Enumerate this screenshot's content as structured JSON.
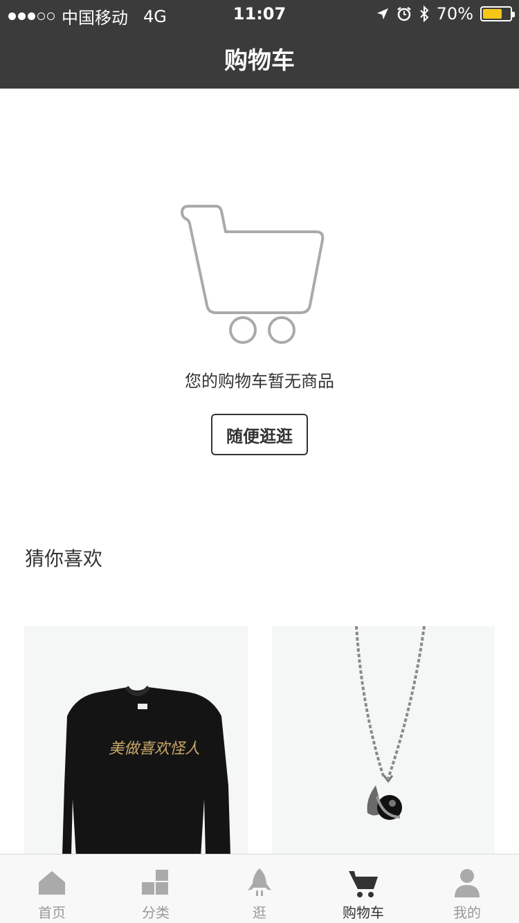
{
  "status_bar": {
    "carrier": "中国移动",
    "network": "4G",
    "time": "11:07",
    "battery": "70%",
    "battery_level": 0.7
  },
  "nav": {
    "title": "购物车"
  },
  "empty_state": {
    "message": "您的购物车暂无商品",
    "button_label": "随便逛逛"
  },
  "recommend": {
    "title": "猜你喜欢",
    "products": [
      {
        "icon": "sweatshirt-image",
        "print": "美做喜欢怪人"
      },
      {
        "icon": "necklace-image"
      }
    ]
  },
  "tabbar": {
    "items": [
      {
        "label": "首页",
        "icon": "home-icon",
        "active": false
      },
      {
        "label": "分类",
        "icon": "category-icon",
        "active": false
      },
      {
        "label": "逛",
        "icon": "rocket-icon",
        "active": false
      },
      {
        "label": "购物车",
        "icon": "cart-icon",
        "active": true
      },
      {
        "label": "我的",
        "icon": "user-icon",
        "active": false
      }
    ]
  },
  "colors": {
    "header_bg": "#3b3b3b",
    "battery_fill": "#f5c518",
    "tab_active": "#333333",
    "tab_inactive": "#999999"
  }
}
